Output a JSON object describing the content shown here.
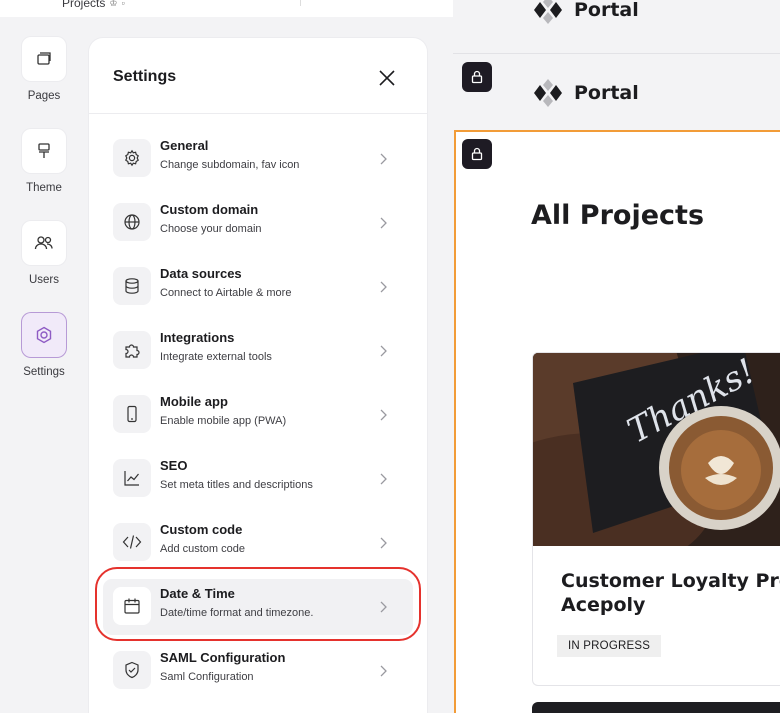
{
  "topbar": {
    "breadcrumb": "Projects"
  },
  "rail": {
    "items": [
      {
        "label": "Pages",
        "icon": "pages-icon"
      },
      {
        "label": "Theme",
        "icon": "paint-roller-icon"
      },
      {
        "label": "Users",
        "icon": "users-icon"
      },
      {
        "label": "Settings",
        "icon": "settings-icon"
      }
    ]
  },
  "settings": {
    "title": "Settings",
    "items": [
      {
        "title": "General",
        "desc": "Change subdomain, fav icon",
        "icon": "gear-icon"
      },
      {
        "title": "Custom domain",
        "desc": "Choose your domain",
        "icon": "globe-icon"
      },
      {
        "title": "Data sources",
        "desc": "Connect to Airtable & more",
        "icon": "database-icon"
      },
      {
        "title": "Integrations",
        "desc": "Integrate external tools",
        "icon": "puzzle-icon"
      },
      {
        "title": "Mobile app",
        "desc": "Enable mobile app (PWA)",
        "icon": "mobile-icon"
      },
      {
        "title": "SEO",
        "desc": "Set meta titles and descriptions",
        "icon": "chart-line-icon"
      },
      {
        "title": "Custom code",
        "desc": "Add custom code",
        "icon": "code-icon"
      },
      {
        "title": "Date & Time",
        "desc": "Date/time format and timezone.",
        "icon": "calendar-icon"
      },
      {
        "title": "SAML Configuration",
        "desc": "Saml Configuration",
        "icon": "shield-check-icon"
      }
    ]
  },
  "canvas": {
    "brand": "Portal",
    "page_title": "All Projects",
    "card": {
      "title_line1": "Customer Loyalty Prog",
      "title_line2": "Acepoly",
      "status": "IN PROGRESS",
      "image_caption": "Thanks!"
    }
  },
  "colors": {
    "accent": "#8e5bc4",
    "highlight_ring": "#e5322d",
    "frame_orange": "#f29c38",
    "dark": "#1e1b24"
  }
}
